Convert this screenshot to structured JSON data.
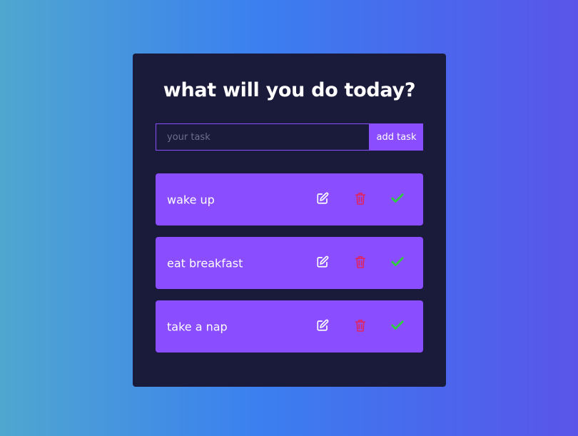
{
  "header": {
    "title": "what will you do today?"
  },
  "task_form": {
    "placeholder": "your task",
    "value": "",
    "add_label": "add task"
  },
  "tasks": [
    {
      "label": "wake up",
      "edit_icon": "edit-icon",
      "delete_icon": "trash-icon",
      "complete_icon": "check-icon"
    },
    {
      "label": "eat breakfast",
      "edit_icon": "edit-icon",
      "delete_icon": "trash-icon",
      "complete_icon": "check-icon"
    },
    {
      "label": "take a nap",
      "edit_icon": "edit-icon",
      "delete_icon": "trash-icon",
      "complete_icon": "check-icon"
    }
  ],
  "colors": {
    "card_background": "#1a1a3a",
    "accent": "#8a4dff",
    "delete": "#e0245e",
    "complete": "#2ecc40",
    "text": "#ffffff"
  }
}
